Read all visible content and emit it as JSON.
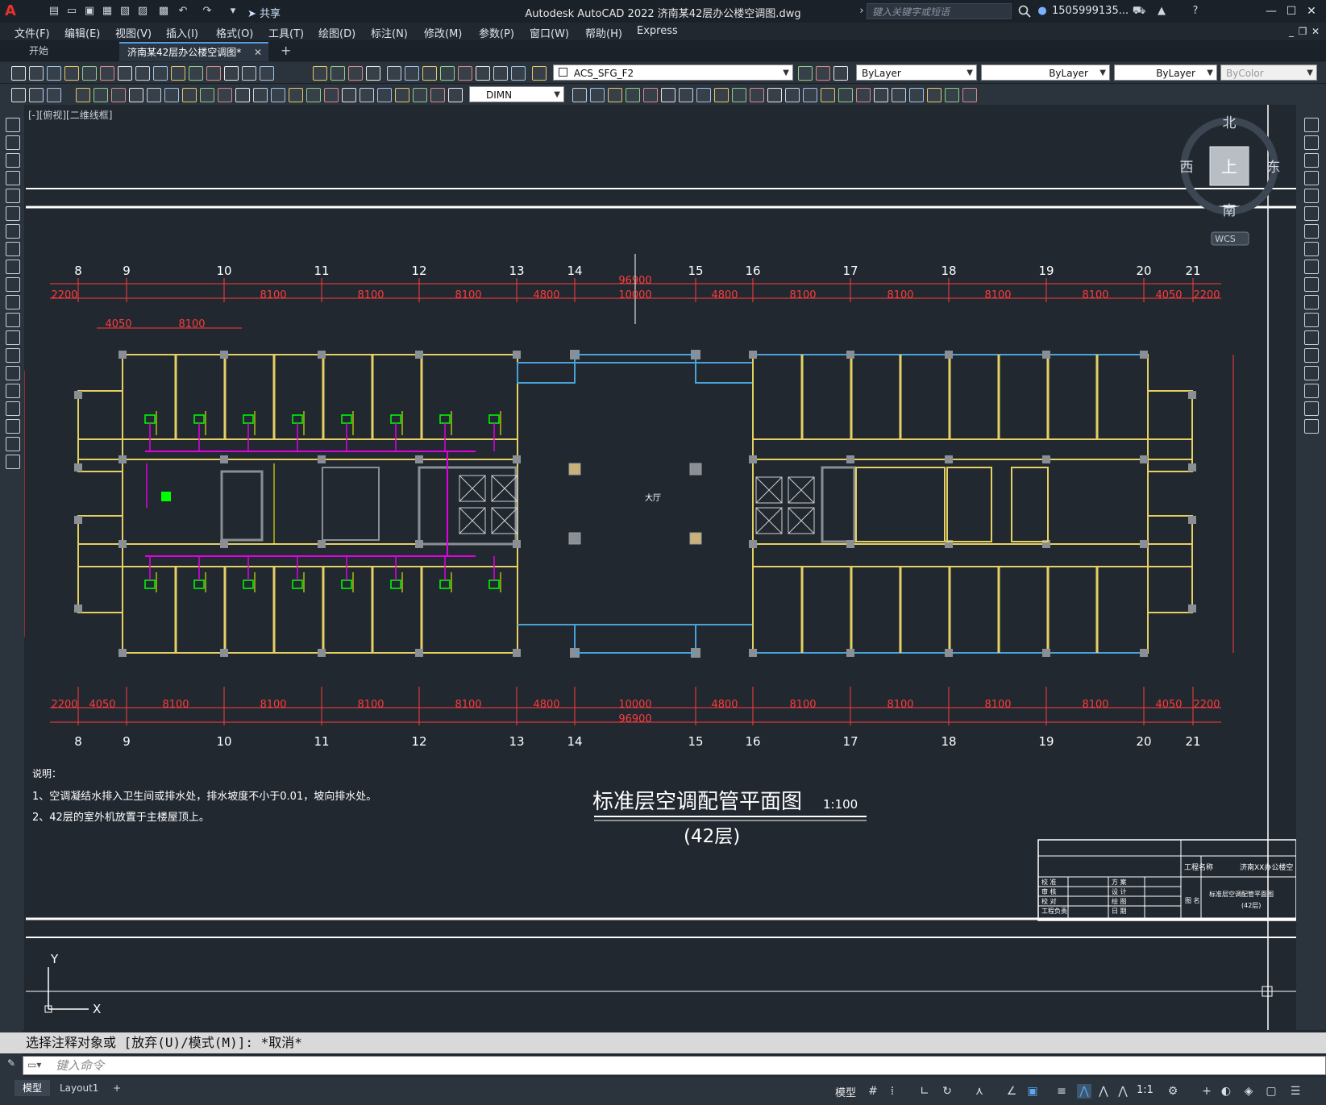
{
  "window": {
    "title": "Autodesk AutoCAD 2022    济南某42层办公楼空调图.dwg",
    "share_label": "共享",
    "search_placeholder": "键入关键字或短语",
    "user": "1505999135...",
    "app_letter": "A"
  },
  "menu": [
    "文件(F)",
    "编辑(E)",
    "视图(V)",
    "插入(I)",
    "格式(O)",
    "工具(T)",
    "绘图(D)",
    "标注(N)",
    "修改(M)",
    "参数(P)",
    "窗口(W)",
    "帮助(H)",
    "Express"
  ],
  "tabs": {
    "start": "开始",
    "drawing": "济南某42层办公楼空调图*"
  },
  "toolbar": {
    "layer": "ACS_SFG_F2",
    "color": "ByLayer",
    "linetype": "ByLayer",
    "lineweight": "ByLayer",
    "plotstyle": "ByColor",
    "dimstyle": "DIMN"
  },
  "viewport_label": "[-][俯视][二维线框]",
  "viewcube": {
    "north": "北",
    "south": "南",
    "east": "东",
    "west": "西",
    "top": "上",
    "wcs": "WCS"
  },
  "axes_top": [
    "8",
    "9",
    "10",
    "11",
    "12",
    "13",
    "14",
    "15",
    "16",
    "17",
    "18",
    "19",
    "20",
    "21"
  ],
  "dims_top_total": "96900",
  "dims_top_row": [
    "2200",
    "8100",
    "8100",
    "8100",
    "4800",
    "10000",
    "4800",
    "8100",
    "8100",
    "8100",
    "8100",
    "4050",
    "2200"
  ],
  "dims_sub": [
    "4050",
    "8100"
  ],
  "dims_bottom_row": [
    "2200",
    "4050",
    "8100",
    "8100",
    "8100",
    "8100",
    "4800",
    "10000",
    "4800",
    "8100",
    "8100",
    "8100",
    "8100",
    "4050",
    "2200"
  ],
  "dims_bottom_total": "96900",
  "notes": {
    "title": "说明：",
    "line1": "1、空调凝结水排入卫生间或排水处，排水坡度不小于0.01，坡向排水处。",
    "line2": "2、42层的室外机放置于主楼屋顶上。"
  },
  "drawing_title": "标准层空调配管平面图",
  "drawing_scale": "1:100",
  "drawing_subtitle": "(42层)",
  "hall_label": "大厅",
  "titleblock": {
    "project_label": "工程名称",
    "project_value": "济南XX办公楼空",
    "rows_left": [
      "校 准",
      "审 核",
      "校 对",
      "工程负责"
    ],
    "rows_mid": [
      "方 案",
      "设 计",
      "绘 图",
      "日 期"
    ],
    "drawing_label": "图 名",
    "drawing_value": "标准层空调配管平面图",
    "drawing_value2": "(42层)"
  },
  "ucs": {
    "x": "X",
    "y": "Y"
  },
  "command": {
    "history": "选择注释对象或 [放弃(U)/模式(M)]: *取消*",
    "placeholder": "键入命令"
  },
  "layout_tabs": [
    "模型",
    "Layout1"
  ],
  "status": {
    "model": "模型",
    "scale": "1:1"
  },
  "colors": {
    "dim_red": "#ff3b3b",
    "text_white": "#ffffff",
    "wall_yellow": "#e8d36a",
    "duct_magenta": "#e000e0",
    "equip_green": "#00ff00",
    "glass_cyan": "#4aa3d8"
  }
}
